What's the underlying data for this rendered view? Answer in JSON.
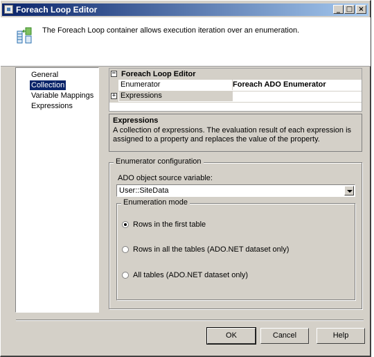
{
  "window": {
    "title": "Foreach Loop Editor"
  },
  "header": {
    "description": "The Foreach Loop container allows execution iteration over an enumeration.",
    "icon": "foreach-loop-icon"
  },
  "nav": {
    "items": [
      "General",
      "Collection",
      "Variable Mappings",
      "Expressions"
    ],
    "selected": "Collection"
  },
  "properties": {
    "category": "Foreach Loop Editor",
    "rows": [
      {
        "name": "Enumerator",
        "value": "Foreach ADO Enumerator"
      },
      {
        "name": "Expressions",
        "value": ""
      }
    ]
  },
  "description": {
    "title": "Expressions",
    "body": "A collection of expressions. The evaluation result of each expression is assigned to a property and replaces the value of the property."
  },
  "enumerator_config": {
    "label": "Enumerator configuration",
    "source_label": "ADO object source variable:",
    "source_value": "User::SiteData",
    "mode_label": "Enumeration mode",
    "options": [
      "Rows in the first table",
      "Rows in all the tables (ADO.NET dataset only)",
      "All tables (ADO.NET dataset only)"
    ],
    "selected_option": "Rows in the first table"
  },
  "buttons": {
    "ok": "OK",
    "cancel": "Cancel",
    "help": "Help"
  },
  "colors": {
    "title_bar": "#0a246a",
    "selection": "#0a246a",
    "dialog_face": "#d4d0c8"
  }
}
